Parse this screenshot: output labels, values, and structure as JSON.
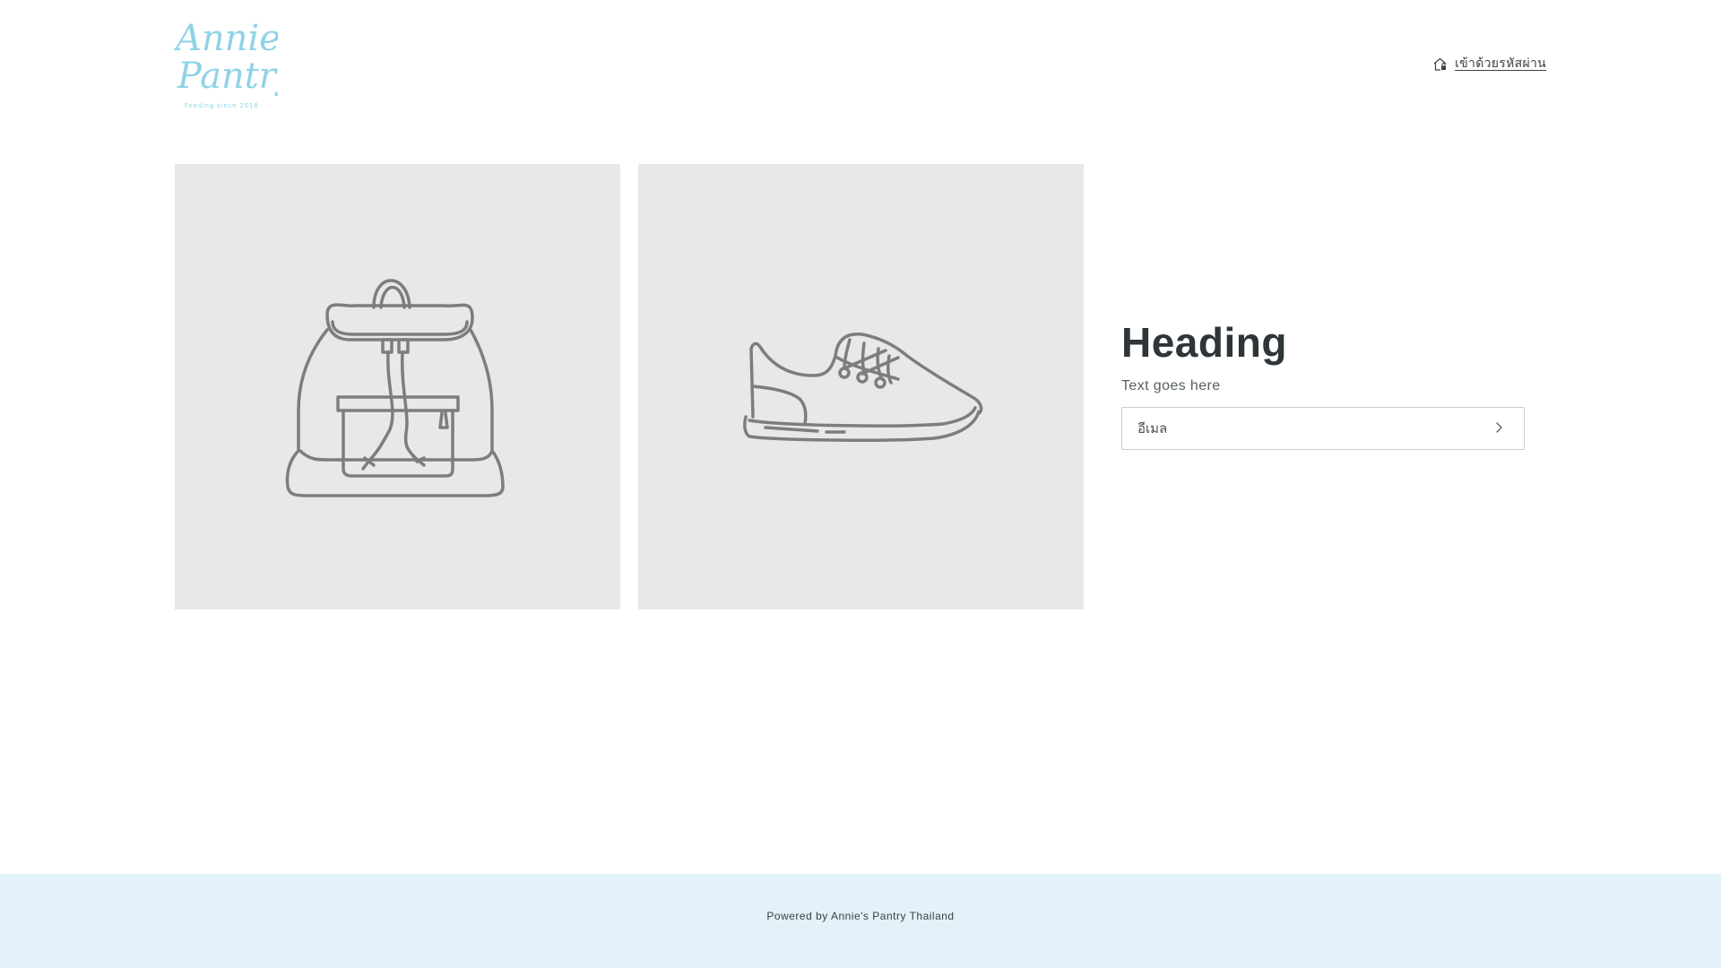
{
  "brand": {
    "logo_line1": "Annie's",
    "logo_line2": "Pantry",
    "logo_tagline": "Feeding since 2018",
    "logo_color": "#8fd3e6"
  },
  "header": {
    "login_label": "เข้าด้วยรหัสผ่าน",
    "login_icon": "lock-house-icon"
  },
  "images": [
    {
      "icon": "backpack-placeholder-icon"
    },
    {
      "icon": "sneaker-placeholder-icon"
    }
  ],
  "main": {
    "heading": "Heading",
    "subtext": "Text goes here",
    "email_placeholder": "อีเมล",
    "submit_icon": "chevron-right-icon"
  },
  "footer": {
    "powered_by": "Powered by Annie's Pantry Thailand",
    "background_color": "#e3f2f8"
  }
}
